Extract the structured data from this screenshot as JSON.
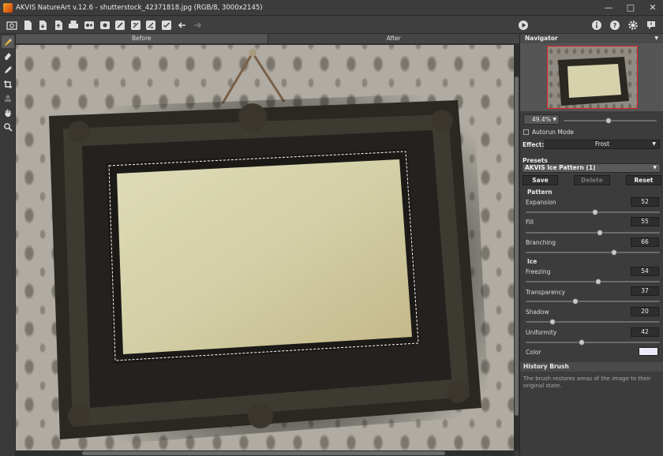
{
  "window": {
    "title": "AKVIS NatureArt v.12.6 - shutterstock_42371818.jpg (RGB/8, 3000x2145)",
    "controls": [
      "minimize-icon",
      "maximize-icon",
      "close-icon"
    ]
  },
  "toolbar": {
    "left_icons": [
      "home-icon",
      "open-file-icon",
      "save-file-icon",
      "export-icon",
      "print-icon",
      "batch-icon",
      "batch-settings-icon",
      "brush-icon",
      "brush-preset-icon",
      "settings-brush-icon",
      "back-arrow-icon",
      "forward-arrow-icon"
    ],
    "right_icons": [
      "run-icon",
      "info-icon",
      "help-icon",
      "gear-icon",
      "feedback-icon"
    ]
  },
  "tools": [
    "history-brush-icon",
    "eraser-icon",
    "pencil-icon",
    "crop-icon",
    "stamp-icon",
    "hand-icon",
    "zoom-icon"
  ],
  "tabs": {
    "before": "Before",
    "after": "After"
  },
  "navigator": {
    "title": "Navigator",
    "zoom": "49.4%",
    "zoom_slider": 0.48
  },
  "settings": {
    "autorun_label": "Autorun Mode",
    "effect_label": "Effect:",
    "effect_value": "Frost"
  },
  "presets": {
    "label": "Presets",
    "current": "AKVIS Ice Pattern (1)",
    "save": "Save",
    "delete": "Delete",
    "reset": "Reset"
  },
  "pattern": {
    "label": "Pattern",
    "params": [
      {
        "name": "Expansion",
        "value": "52",
        "level": 0.52
      },
      {
        "name": "Fill",
        "value": "55",
        "level": 0.55
      },
      {
        "name": "Branching",
        "value": "66",
        "level": 0.66
      }
    ]
  },
  "ice": {
    "label": "Ice",
    "params": [
      {
        "name": "Freezing",
        "value": "54",
        "level": 0.54
      },
      {
        "name": "Transparency",
        "value": "37",
        "level": 0.37
      },
      {
        "name": "Shadow",
        "value": "20",
        "level": 0.2
      },
      {
        "name": "Uniformity",
        "value": "42",
        "level": 0.42
      }
    ],
    "color_label": "Color",
    "color": "#ece9f8"
  },
  "history_brush": {
    "title": "History Brush",
    "description": "The brush restores areas of the image to their original state."
  }
}
